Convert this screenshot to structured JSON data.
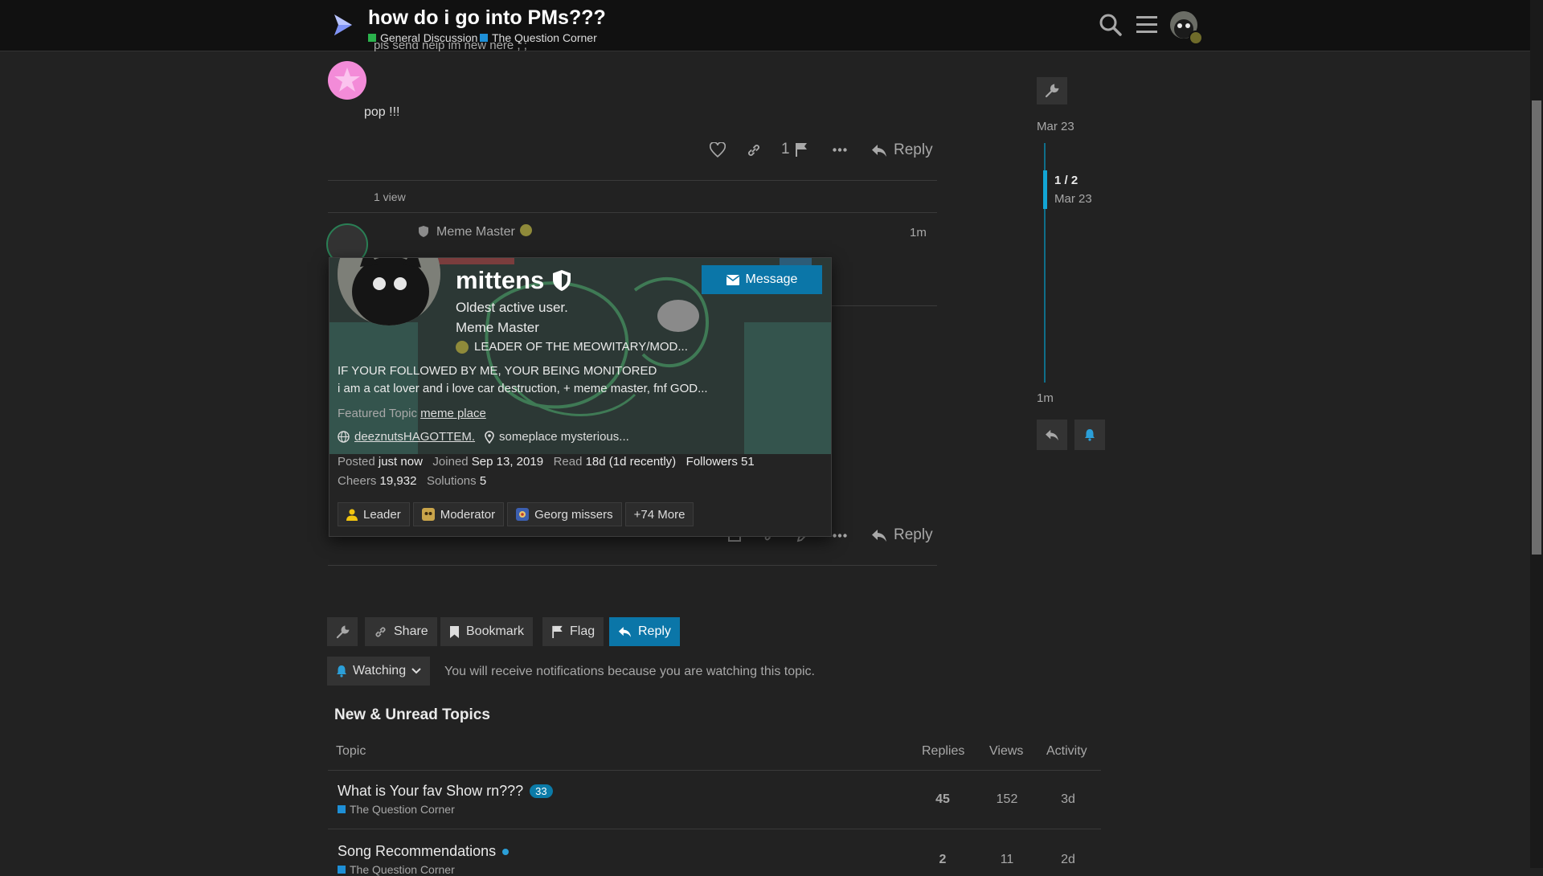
{
  "header": {
    "title": "how do i go into PMs???",
    "categories": [
      {
        "label": "General Discussion",
        "color": "#2bb24c"
      },
      {
        "label": "The Question Corner",
        "color": "#1e8fd6"
      }
    ]
  },
  "post_prev": {
    "cut_text": "pls send help im new here ; ;",
    "body": "pop !!!",
    "flag_count": "1",
    "reply_label": "Reply",
    "views": "1 view"
  },
  "post_main": {
    "user_title": "Meme Master",
    "time": "1m",
    "reply_label": "Reply"
  },
  "user_card": {
    "username": "mittens",
    "message_label": "Message",
    "bio_short": "Oldest active user.",
    "title": "Meme Master",
    "flair_group": "LEADER OF THE MEOWITARY/MOD...",
    "bio_line1": "IF YOUR FOLLOWED BY ME, YOUR BEING MONITORED",
    "bio_line2": "i am a cat lover and i love car destruction, + meme master, fnf GOD...",
    "featured_label": "Featured Topic",
    "featured_topic": "meme place",
    "website": "deeznutsHAGOTTEM.",
    "location": "someplace mysterious...",
    "stats": {
      "posted_label": "Posted",
      "posted": "just now",
      "joined_label": "Joined",
      "joined": "Sep 13, 2019",
      "read_label": "Read",
      "read": "18d (1d recently)",
      "followers_label": "Followers",
      "followers": "51",
      "cheers_label": "Cheers",
      "cheers": "19,932",
      "solutions_label": "Solutions",
      "solutions": "5"
    },
    "badges": [
      {
        "label": "Leader"
      },
      {
        "label": "Moderator"
      },
      {
        "label": "Georg missers"
      }
    ],
    "more_badges": "+74 More"
  },
  "timeline": {
    "top_date": "Mar 23",
    "position": "1 / 2",
    "position_date": "Mar 23",
    "bottom": "1m"
  },
  "footer_buttons": {
    "share": "Share",
    "bookmark": "Bookmark",
    "flag": "Flag",
    "reply": "Reply"
  },
  "notifications": {
    "level": "Watching",
    "description": "You will receive notifications because you are watching this topic."
  },
  "suggested": {
    "heading": "New & Unread Topics",
    "columns": [
      "Topic",
      "Replies",
      "Views",
      "Activity"
    ],
    "rows": [
      {
        "title": "What is Your fav Show rn???",
        "new_count": "33",
        "category": "The Question Corner",
        "replies": "45",
        "views": "152",
        "activity": "3d"
      },
      {
        "title": "Song Recommendations",
        "new_count": "",
        "category": "The Question Corner",
        "replies": "2",
        "views": "11",
        "activity": "2d"
      }
    ]
  },
  "colors": {
    "accent": "#0b76a8",
    "background": "#222222",
    "header": "#111111"
  }
}
